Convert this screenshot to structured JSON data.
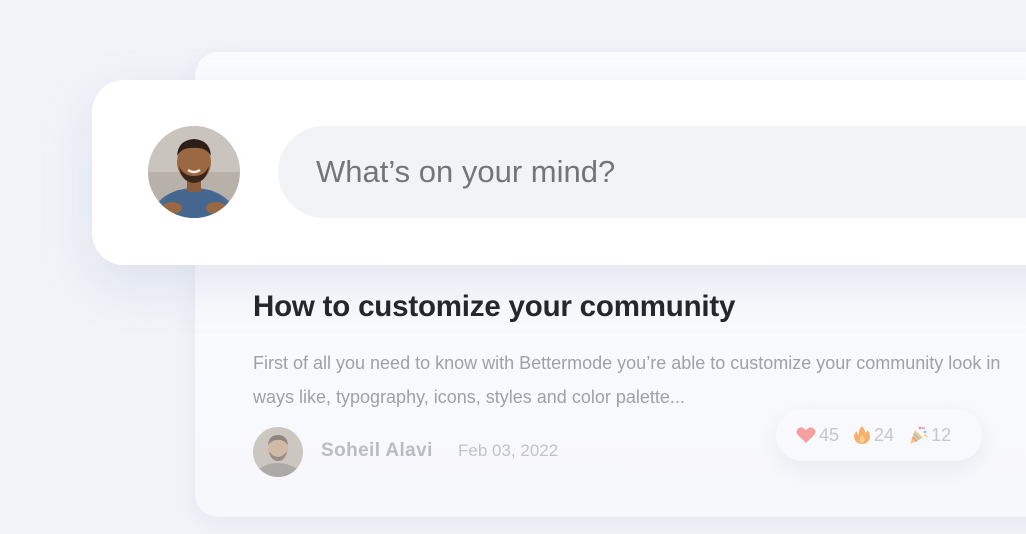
{
  "composer": {
    "placeholder": "What’s on your mind?"
  },
  "post": {
    "title": "How to customize your community",
    "excerpt_lines": [
      "First of all you need to know with Bettermode you’re able to customize your community look in",
      "ways like, typography, icons, styles and color palette..."
    ],
    "author": "Soheil Alavi",
    "date": "Feb 03, 2022"
  },
  "reactions": [
    {
      "icon": "heart-icon",
      "count": "45"
    },
    {
      "icon": "fire-icon",
      "count": "24"
    },
    {
      "icon": "party-popper-icon",
      "count": "12"
    }
  ],
  "colors": {
    "background": "#f1f3f8",
    "title": "#25272c",
    "muted_text": "#9ea1a8",
    "heart": "#f28b8b",
    "fire": "#f6a04d"
  }
}
